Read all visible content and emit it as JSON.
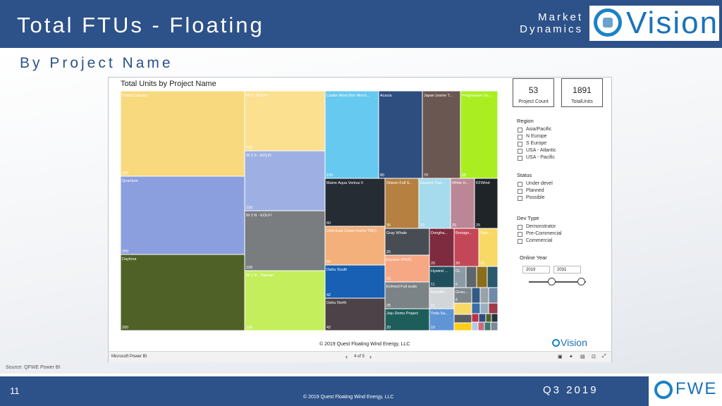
{
  "slide": {
    "title": "Total FTUs - Floating",
    "header_right": [
      "Market",
      "Dynamics"
    ],
    "logo_text": "Vision",
    "subtitle": "By Project Name",
    "source": "Source: QFWE Power BI",
    "page_number": "11",
    "copyright": "© 2019 Quest Floating Wind Energy, LLC",
    "period": "Q3 2019",
    "footer_logo": "FWE"
  },
  "report": {
    "app_label": "Microsoft Power BI",
    "pager": "4 of 5",
    "inner_copyright": "© 2019 Quest Floating Wind Energy, LLC",
    "logo_text": "Vision"
  },
  "kpis": [
    {
      "value": "53",
      "label": "Project Count"
    },
    {
      "value": "1891",
      "label": "TotalUnits"
    }
  ],
  "slicers": {
    "region": {
      "title": "Region",
      "items": [
        "Asia/Pacific",
        "N Europe",
        "S Europe",
        "USA - Atlantic",
        "USA - Pacific"
      ]
    },
    "status": {
      "title": "Status",
      "items": [
        "Under devel",
        "Planned",
        "Possible"
      ]
    },
    "dev_type": {
      "title": "Dev Type",
      "items": [
        "Demonstrator",
        "Pre-Commercial",
        "Commercial"
      ]
    },
    "online_year": {
      "title": "Online Year",
      "from": "2019",
      "to": "2031",
      "range": [
        2019,
        2031
      ]
    }
  },
  "chart_data": {
    "type": "treemap",
    "title": "Total Units by Project Name",
    "items": [
      {
        "name": "Diablo Canyon",
        "value": 200,
        "color": "#f9d97e"
      },
      {
        "name": "Quantum",
        "value": 200,
        "color": "#8b9fde"
      },
      {
        "name": "Daytona",
        "value": 200,
        "color": "#4f6127"
      },
      {
        "name": "W 3 - EOLFI",
        "value": 100,
        "color": "#fbe08f"
      },
      {
        "name": "W 2 S - EOLFI",
        "value": 100,
        "color": "#9eb0e3"
      },
      {
        "name": "W 2 N - EOLFI",
        "value": 100,
        "color": "#7a7d80"
      },
      {
        "name": "W 1 N - Taiyuan",
        "value": 100,
        "color": "#c4ee5c"
      },
      {
        "name": "Castle Wind (fmr Morro...",
        "value": 100,
        "color": "#66c9ef"
      },
      {
        "name": "Acacia",
        "value": 80,
        "color": "#2e4e80"
      },
      {
        "name": "Japan (name T...",
        "value": 70,
        "color": "#6b5752"
      },
      {
        "name": "Progression So...",
        "value": 68,
        "color": "#aaee22"
      },
      {
        "name": "Maine Aqua Ventus II",
        "value": 60,
        "color": "#262c34"
      },
      {
        "name": "Shizen Full S...",
        "value": 35,
        "color": "#b58040"
      },
      {
        "name": "Equinor Can...",
        "value": 33,
        "color": "#a5dbec"
      },
      {
        "name": "White H...",
        "value": 25,
        "color": "#bb8796"
      },
      {
        "name": "KFWind",
        "value": 25,
        "color": "#1e2428"
      },
      {
        "name": "USA East Coast (name TBD)",
        "value": 50,
        "color": "#f4b07a"
      },
      {
        "name": "Gray Whale",
        "value": 25,
        "color": "#474d52"
      },
      {
        "name": "Dongha...",
        "value": 20,
        "color": "#7e2a3f"
      },
      {
        "name": "Bretagn...",
        "value": 20,
        "color": "#c44758"
      },
      {
        "name": "Sein...",
        "value": 15,
        "color": "#f8d966"
      },
      {
        "name": "Equinor KNOC",
        "value": 25,
        "color": "#f6a783"
      },
      {
        "name": "Oahu South",
        "value": 42,
        "color": "#1760b4"
      },
      {
        "name": "Hywind ...",
        "value": 11,
        "color": "#1f4e5c"
      },
      {
        "name": "Gl...",
        "value": 6,
        "color": "#8b9aa4"
      },
      {
        "name": "Eolmed Full scale",
        "value": 25,
        "color": "#7c8386"
      },
      {
        "name": "Nice/BF...",
        "value": 11,
        "color": "#d3d6d8"
      },
      {
        "name": "Groix...",
        "value": 8,
        "color": "#7f868b"
      },
      {
        "name": "Oahu North",
        "value": 42,
        "color": "#4d4247"
      },
      {
        "name": "Jeju Demo Project",
        "value": 20,
        "color": "#1d5e5b"
      },
      {
        "name": "Toda Sa...",
        "value": 10,
        "color": "#5f95d6"
      }
    ]
  }
}
